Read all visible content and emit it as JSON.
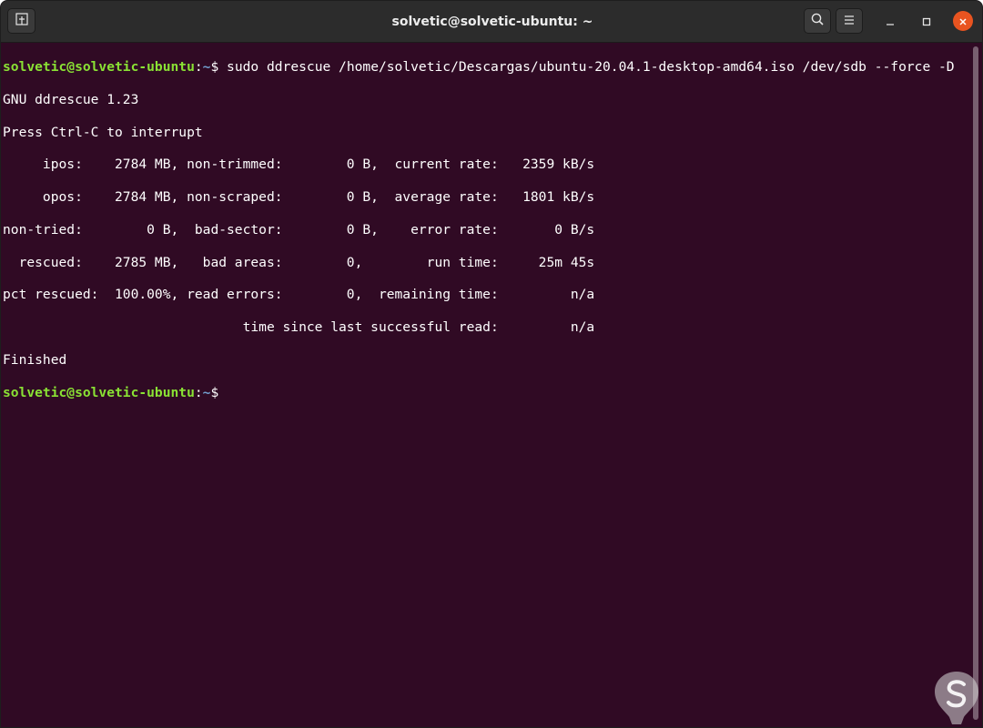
{
  "window": {
    "title": "solvetic@solvetic-ubuntu: ~"
  },
  "icons": {
    "new_tab": "new-tab-icon",
    "search": "search-icon",
    "menu": "hamburger-menu-icon",
    "minimize": "minimize-icon",
    "maximize": "maximize-icon",
    "close": "close-icon",
    "watermark": "solvetic-logo"
  },
  "colors": {
    "terminal_bg": "#300a24",
    "prompt_user": "#8ae234",
    "prompt_path": "#729fcf",
    "close_button": "#e95420",
    "titlebar": "#2c2c2c"
  },
  "terminal": {
    "prompt_user": "solvetic@solvetic-ubuntu",
    "prompt_sep": ":",
    "prompt_path": "~",
    "prompt_dollar": "$",
    "command": " sudo ddrescue /home/solvetic/Descargas/ubuntu-20.04.1-desktop-amd64.iso /dev/sdb --force -D",
    "output_lines": [
      "GNU ddrescue 1.23",
      "Press Ctrl-C to interrupt",
      "     ipos:    2784 MB, non-trimmed:        0 B,  current rate:   2359 kB/s",
      "     opos:    2784 MB, non-scraped:        0 B,  average rate:   1801 kB/s",
      "non-tried:        0 B,  bad-sector:        0 B,    error rate:       0 B/s",
      "  rescued:    2785 MB,   bad areas:        0,        run time:     25m 45s",
      "pct rescued:  100.00%, read errors:        0,  remaining time:         n/a",
      "                              time since last successful read:         n/a",
      "Finished"
    ],
    "final_prompt_user": "solvetic@solvetic-ubuntu",
    "final_prompt_sep": ":",
    "final_prompt_path": "~",
    "final_prompt_dollar": "$"
  }
}
